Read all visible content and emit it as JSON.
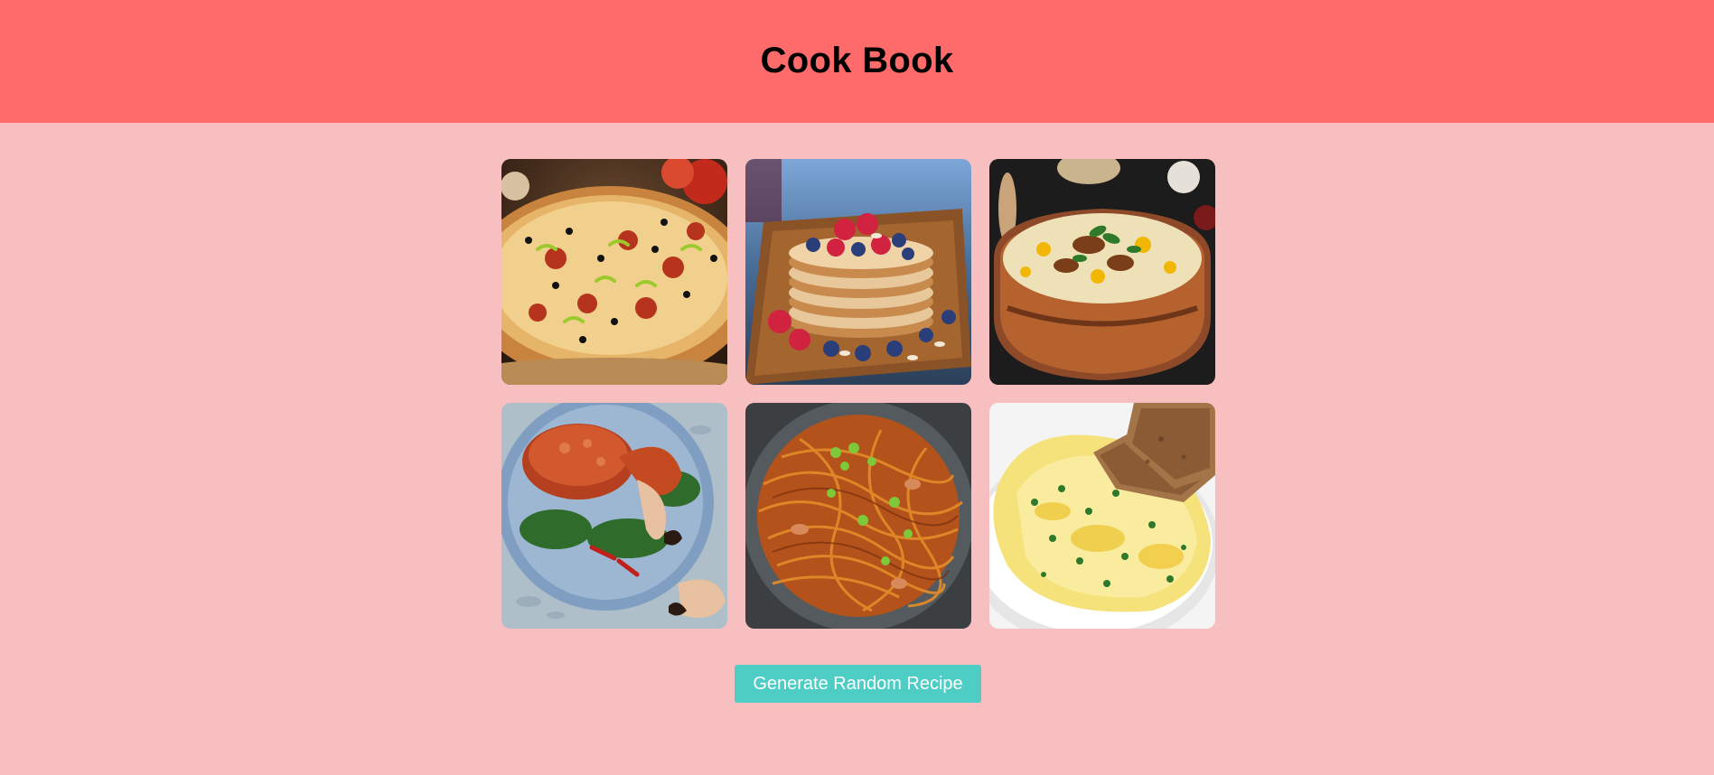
{
  "header": {
    "title": "Cook Book"
  },
  "recipes": [
    {
      "name": "pizza",
      "image": "pizza-image"
    },
    {
      "name": "pancakes",
      "image": "pancakes-image"
    },
    {
      "name": "biryani",
      "image": "biryani-image"
    },
    {
      "name": "crab",
      "image": "crab-image"
    },
    {
      "name": "noodles",
      "image": "noodles-image"
    },
    {
      "name": "omelette",
      "image": "omelette-image"
    }
  ],
  "actions": {
    "generate_label": "Generate Random Recipe"
  },
  "colors": {
    "header_bg": "#ff6b6b",
    "page_bg": "#f7bfbf",
    "button_bg": "#4ecdc4",
    "button_text": "#ffffff"
  }
}
